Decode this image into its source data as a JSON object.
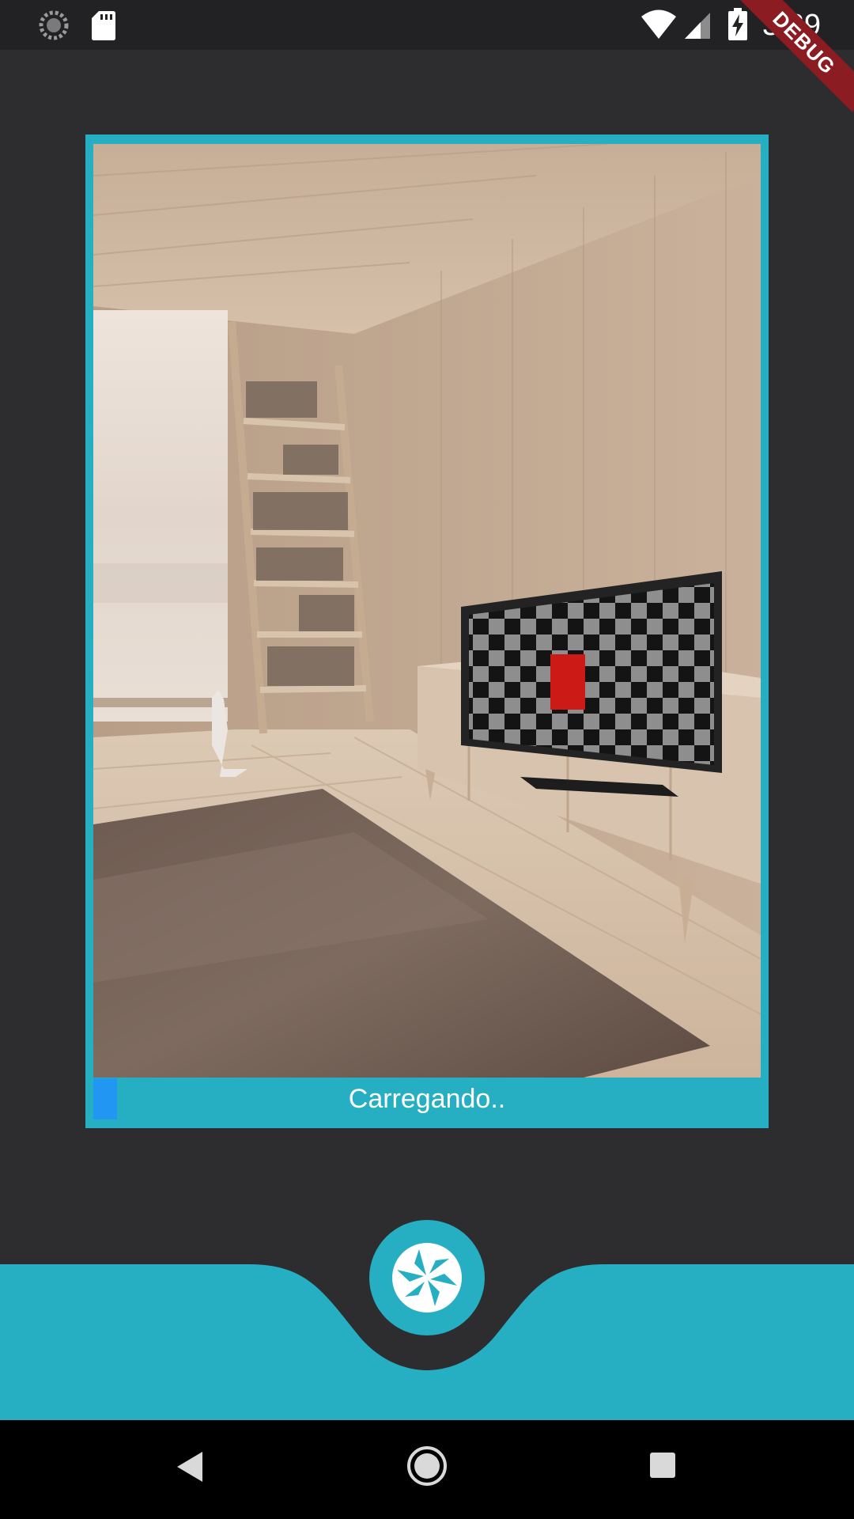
{
  "status_bar": {
    "time": "3:39",
    "left_icons": [
      "sync-icon",
      "sd-card-icon"
    ],
    "right_icons": [
      "wifi-icon",
      "signal-icon",
      "battery-charging-icon"
    ]
  },
  "debug_banner": {
    "label": "DEBUG"
  },
  "camera": {
    "frame_color": "#26aec3",
    "loading_text": "Carregando..",
    "progress": 0.036,
    "progress_color": "#2196f3"
  },
  "bottom_bar": {
    "color": "#26aec3",
    "shutter_icon": "camera-shutter-icon"
  },
  "nav_bar": {
    "icons": [
      "back-icon",
      "home-icon",
      "recents-icon"
    ]
  }
}
